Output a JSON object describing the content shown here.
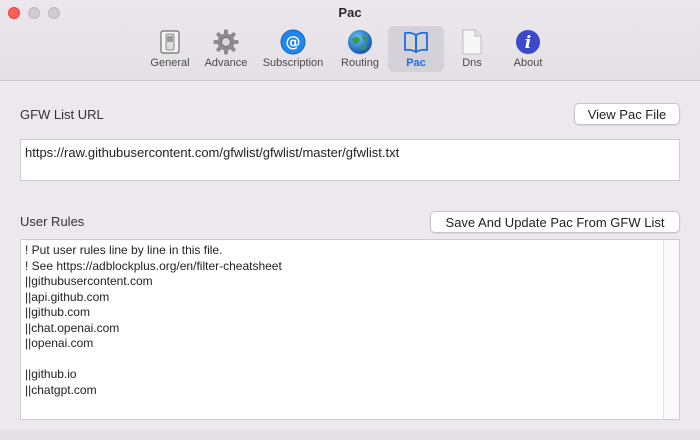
{
  "window": {
    "title": "Pac"
  },
  "toolbar": {
    "items": [
      {
        "label": "General",
        "icon": "switch-icon"
      },
      {
        "label": "Advance",
        "icon": "gear-icon"
      },
      {
        "label": "Subscription",
        "icon": "at-sign-icon"
      },
      {
        "label": "Routing",
        "icon": "globe-icon"
      },
      {
        "label": "Pac",
        "icon": "book-icon",
        "active": true
      },
      {
        "label": "Dns",
        "icon": "document-icon"
      },
      {
        "label": "About",
        "icon": "info-icon"
      }
    ]
  },
  "gfw": {
    "label": "GFW List URL",
    "view_button": "View Pac File",
    "url": "https://raw.githubusercontent.com/gfwlist/gfwlist/master/gfwlist.txt"
  },
  "rules": {
    "label": "User Rules",
    "update_button": "Save And Update Pac From GFW List",
    "lines": [
      "! Put user rules line by line in this file.",
      "! See https://adblockplus.org/en/filter-cheatsheet",
      "||githubusercontent.com",
      "||api.github.com",
      "||github.com",
      "||chat.openai.com",
      "||openai.com",
      "",
      "||github.io",
      "||chatgpt.com"
    ]
  },
  "colors": {
    "accent": "#1a6fe0",
    "close": "#ff5f57",
    "window_bg": "#ece8ee"
  }
}
